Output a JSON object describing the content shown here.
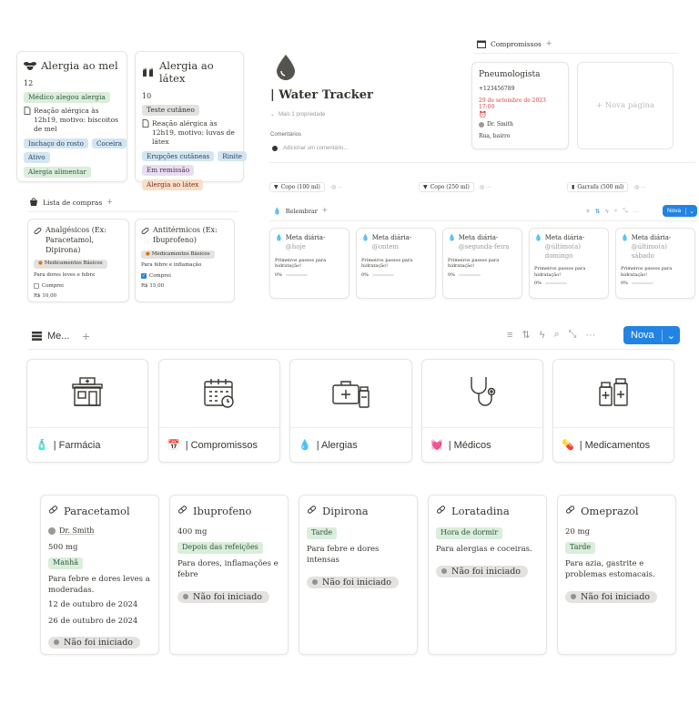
{
  "allergies": [
    {
      "title": "Alergia ao mel",
      "count": "12",
      "tag1": "Médico alegou alergia",
      "desc": "Reação alérgica às 12h19, motivo: biscoitos de mel",
      "symptoms": [
        "Inchaço do rosto",
        "Coceira"
      ],
      "status": "Ativo",
      "type": "Alergia alimentar"
    },
    {
      "title": "Alergia ao látex",
      "count": "10",
      "tag1": "Teste cutâneo",
      "desc": "Reação alérgica às 12h19, motivo: luvas de látex",
      "symptoms": [
        "Erupções cutâneas",
        "Rinite"
      ],
      "status": "Em remissão",
      "type": "Alergia ao látex"
    }
  ],
  "shopping": {
    "title": "Lista de compras",
    "items": [
      {
        "name": "Analgésicos (Ex: Paracetamol, Dipirona)",
        "tag": "Medicamentos Básicos",
        "desc": "Para dores leves e febre",
        "check": "Comprei",
        "checked": false,
        "price": "R$ 10,00"
      },
      {
        "name": "Antitérmicos (Ex: Ibuprofeno)",
        "tag": "Medicamentos Básicos",
        "desc": "Para febre e inflamação",
        "check": "Comprei",
        "checked": true,
        "price": "R$ 15,00"
      }
    ]
  },
  "water": {
    "title": "| Water Tracker",
    "more_props": "Mais 1 propriedade",
    "comments_label": "Comentários",
    "comment_placeholder": "Adicionar um comentário...",
    "buttons": [
      "Copo (100 ml)",
      "Copo (250 ml)",
      "Garrafa (500 ml)"
    ],
    "reminder": "Relembrar",
    "nova": "Nova",
    "goals": [
      {
        "title": "Meta diária-",
        "day": "@hoje",
        "note": "Primeiros passos para hidratação!",
        "pct": "0%"
      },
      {
        "title": "Meta diária-",
        "day": "@ontem",
        "note": "Primeiros passos para hidratação!",
        "pct": "0%"
      },
      {
        "title": "Meta diária-",
        "day": "@segunda-feira",
        "note": "Primeiros passos para hidratação!",
        "pct": "0%"
      },
      {
        "title": "Meta diária-",
        "day": "@último(a) domingo",
        "note": "Primeiros passos para hidratação!",
        "pct": "0%"
      },
      {
        "title": "Meta diária-",
        "day": "@último(a) sábado",
        "note": "Primeiros passos para hidratação!",
        "pct": "0%"
      }
    ]
  },
  "appointments": {
    "title": "Compromissos",
    "card": {
      "name": "Pneumologista",
      "phone": "+123456789",
      "date": "29 de setembro de 2023 17:00",
      "doctor": "Dr. Smith",
      "address": "Rua, bairro"
    },
    "new_page": "+ Nova página"
  },
  "menu": {
    "title": "Me...",
    "nova": "Nova",
    "tiles": [
      {
        "label": "| Farmácia",
        "icon": "pharmacy-icon"
      },
      {
        "label": "| Compromissos",
        "icon": "calendar-icon"
      },
      {
        "label": "| Alergias",
        "icon": "first-aid-kit-icon"
      },
      {
        "label": "| Médicos",
        "icon": "stethoscope-icon"
      },
      {
        "label": "| Medicamentos",
        "icon": "medicine-bottles-icon"
      }
    ]
  },
  "medications": [
    {
      "name": "Paracetamol",
      "doctor": "Dr. Smith",
      "dose": "500 mg",
      "time": "Manhã",
      "desc": "Para febre e dores leves a moderadas.",
      "start": "12 de outubro de 2024",
      "end": "26 de outubro de 2024",
      "status": "Não foi iniciado"
    },
    {
      "name": "Ibuprofeno",
      "dose": "400 mg",
      "time": "Depois das refeições",
      "desc": "Para dores, inflamações e febre",
      "status": "Não foi iniciado"
    },
    {
      "name": "Dipirona",
      "time": "Tarde",
      "desc": "Para febre e dores intensas",
      "status": "Não foi iniciado"
    },
    {
      "name": "Loratadina",
      "time": "Hora de dormir",
      "desc": "Para alergias e coceiras.",
      "status": "Não foi iniciado"
    },
    {
      "name": "Omeprazol",
      "dose": "20 mg",
      "time": "Tarde",
      "desc": "Para azia, gastrite e problemas estomacais.",
      "status": "Não foi iniciado"
    }
  ],
  "colors": {
    "accent": "#2383e2",
    "date_red": "#e03e3e",
    "tag_green": "#dbeddb",
    "tag_blue": "#d3e5ef",
    "tag_orange": "#fadec9",
    "tag_purple": "#e8deee"
  }
}
